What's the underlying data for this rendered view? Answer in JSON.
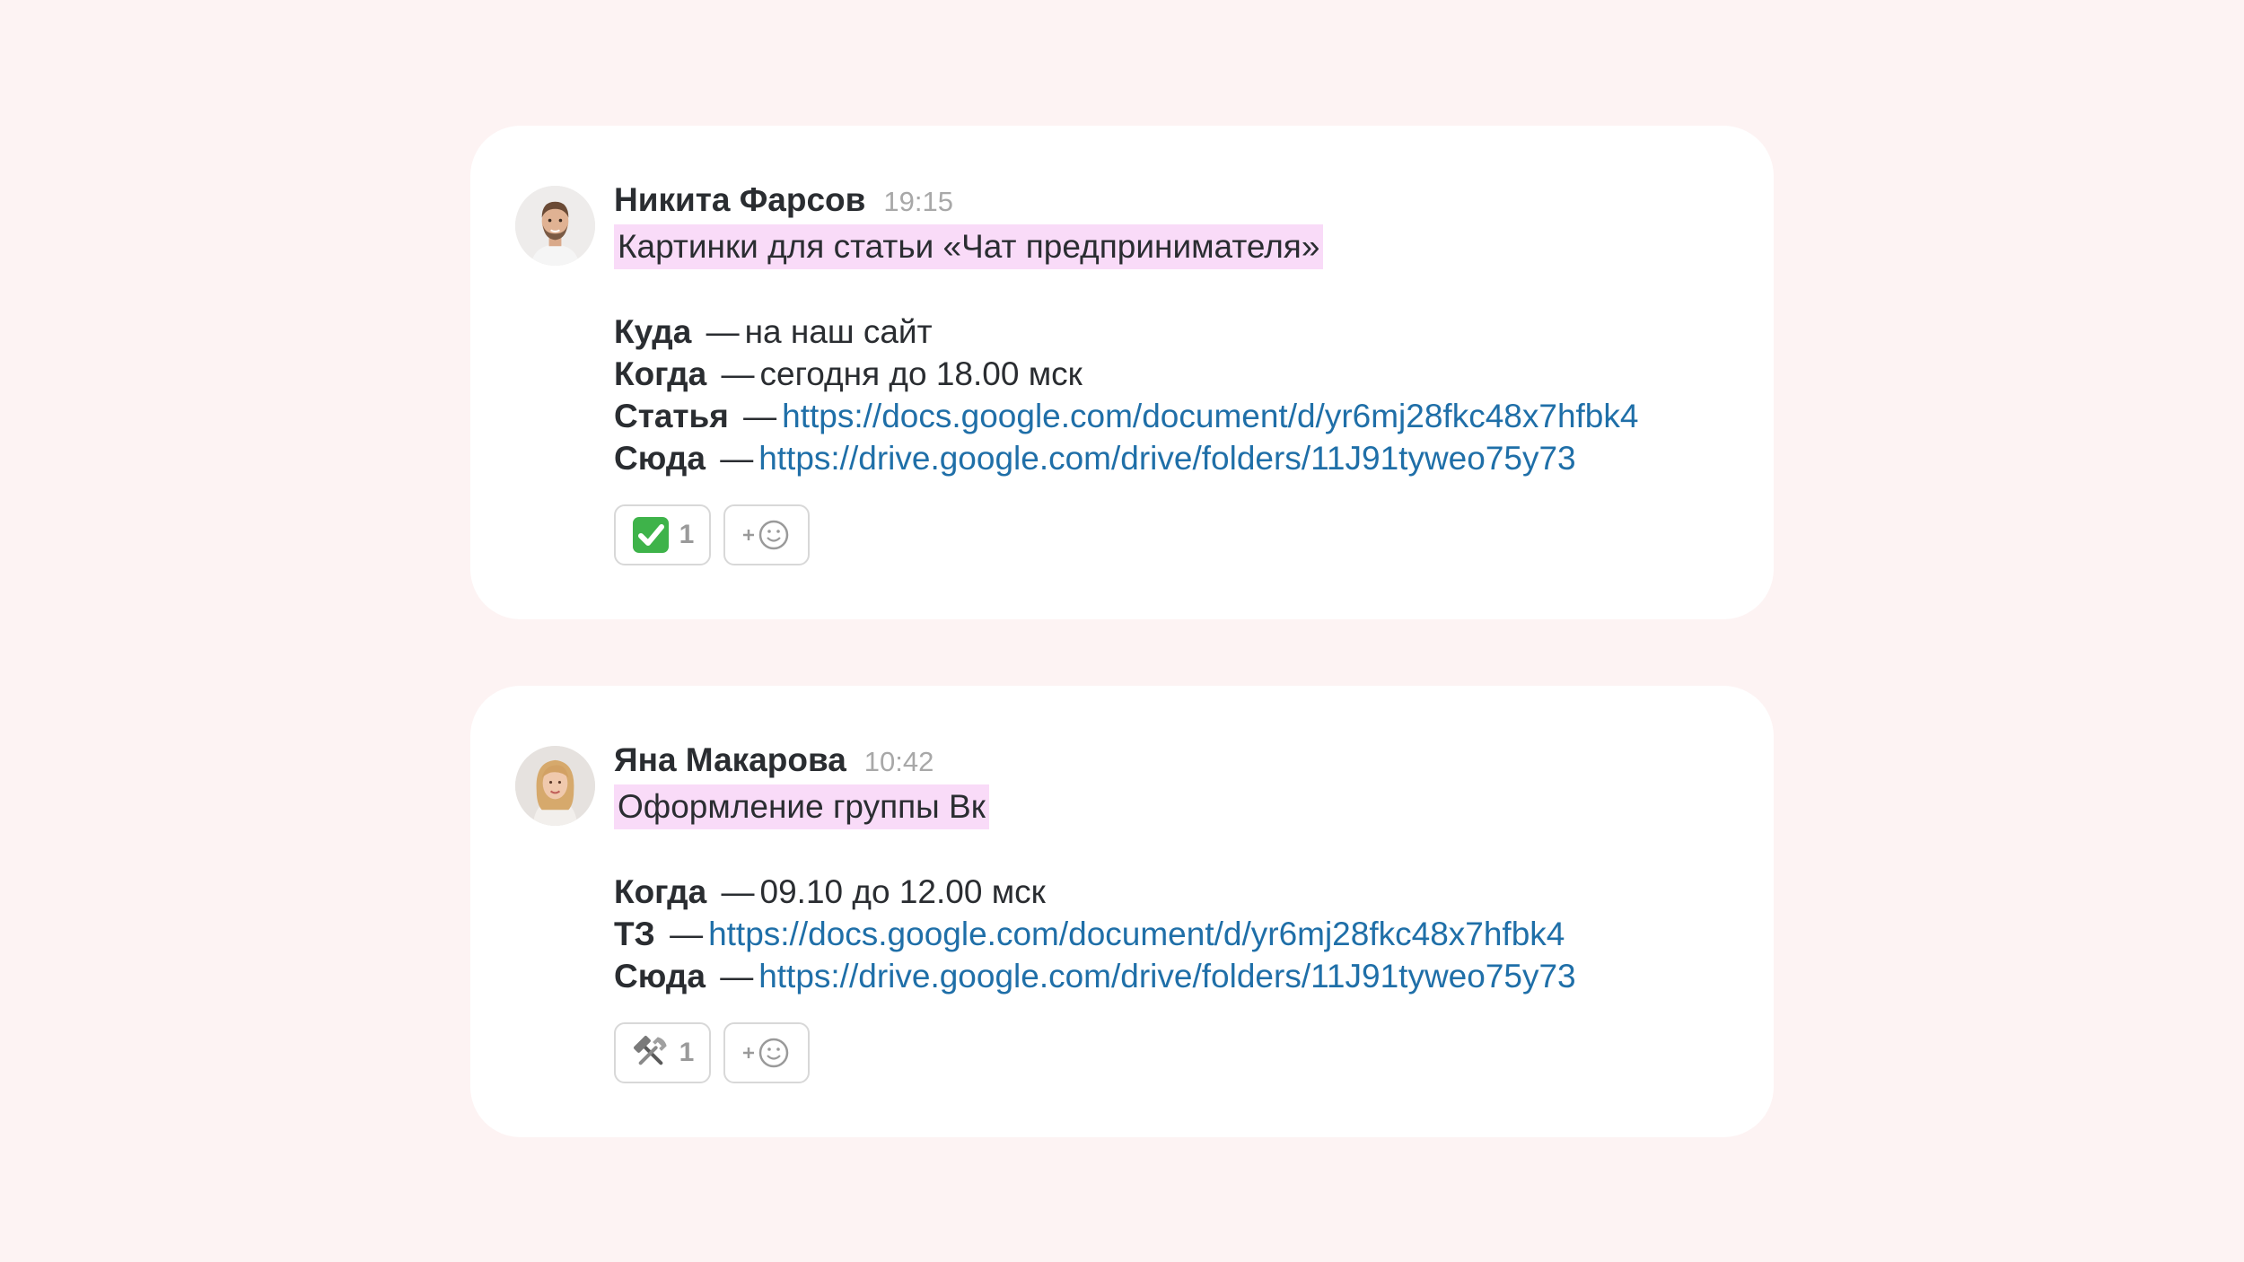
{
  "messages": [
    {
      "author": "Никита Фарсов",
      "time": "19:15",
      "subject": "Картинки для статьи «Чат предпринимателя»",
      "lines": [
        {
          "label": "Куда",
          "sep": "—",
          "text": "на наш сайт"
        },
        {
          "label": "Когда",
          "sep": "—",
          "text": "сегодня до 18.00 мск"
        },
        {
          "label": "Статья",
          "sep": "—",
          "link": "https://docs.google.com/document/d/yr6mj28fkc48x7hfbk4"
        },
        {
          "label": "Сюда",
          "sep": "—",
          "link": "https://drive.google.com/drive/folders/11J91tyweo75y73"
        }
      ],
      "reaction": {
        "icon": "check-mark-icon",
        "count": "1"
      },
      "add_reaction_icon": "add-emoji-icon"
    },
    {
      "author": "Яна Макарова",
      "time": "10:42",
      "subject": "Оформление группы Вк",
      "lines": [
        {
          "label": "Когда",
          "sep": "—",
          "text": "09.10 до 12.00 мск"
        },
        {
          "label": "ТЗ",
          "sep": "—",
          "link": "https://docs.google.com/document/d/yr6mj28fkc48x7hfbk4"
        },
        {
          "label": "Сюда",
          "sep": "—",
          "link": "https://drive.google.com/drive/folders/11J91tyweo75y73"
        }
      ],
      "reaction": {
        "icon": "hammer-and-wrench-icon",
        "count": "1"
      },
      "add_reaction_icon": "add-emoji-icon"
    }
  ],
  "colors": {
    "background": "#fdf3f3",
    "card": "#ffffff",
    "highlight": "#f9dbf8",
    "link": "#1f6fa8",
    "text": "#2a2d31",
    "time": "#a8a8a8"
  }
}
